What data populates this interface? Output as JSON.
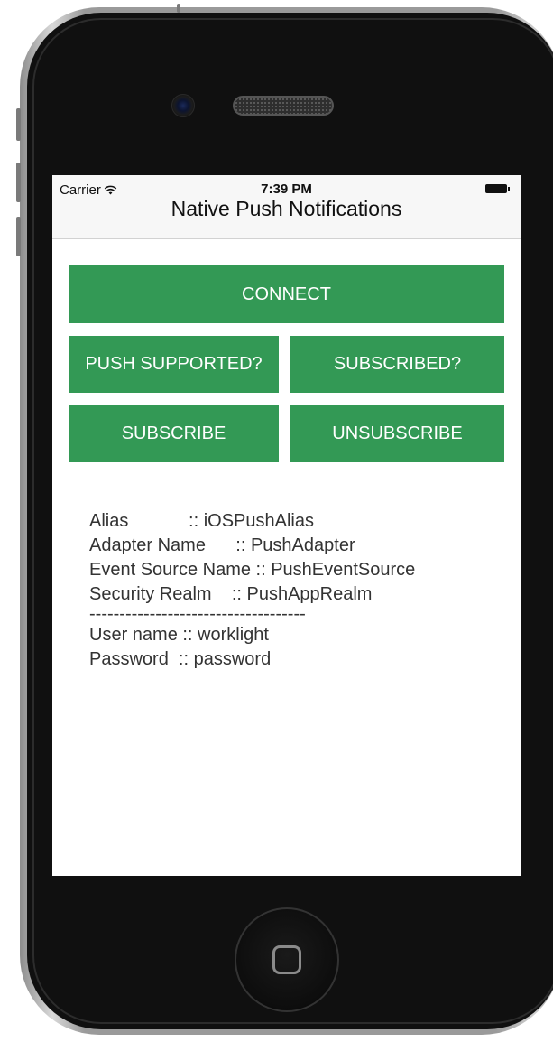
{
  "status_bar": {
    "carrier": "Carrier",
    "wifi_icon": "wifi-icon",
    "time": "7:39 PM",
    "battery_icon": "battery-icon"
  },
  "nav": {
    "title": "Native Push Notifications"
  },
  "buttons": {
    "connect": "CONNECT",
    "push_supported": "PUSH SUPPORTED?",
    "subscribed": "SUBSCRIBED?",
    "subscribe": "SUBSCRIBE",
    "unsubscribe": "UNSUBSCRIBE"
  },
  "info": {
    "alias": "Alias            :: iOSPushAlias",
    "adapter_name": "Adapter Name      :: PushAdapter",
    "event_source_name": "Event Source Name :: PushEventSource",
    "security_realm": "Security Realm    :: PushAppRealm",
    "separator": "------------------------------------",
    "user_name": "User name :: worklight",
    "password": "Password  :: password"
  },
  "colors": {
    "button_green": "#339955",
    "nav_background": "#f7f7f7"
  }
}
